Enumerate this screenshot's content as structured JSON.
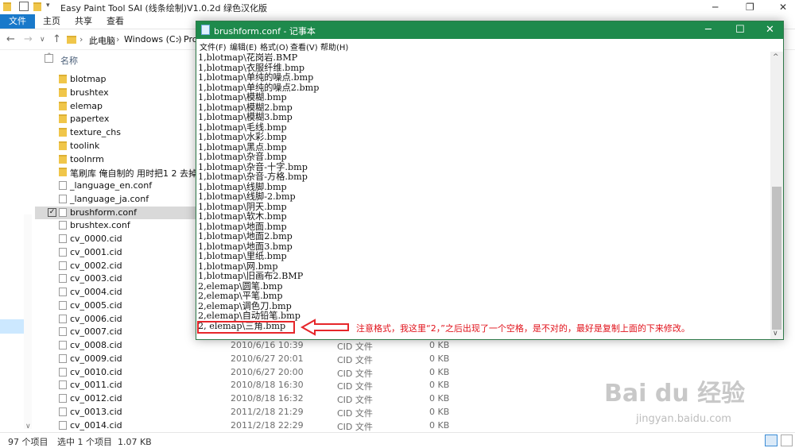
{
  "explorer": {
    "window_title": "Easy Paint Tool SAI (线条绘制)V1.0.2d 绿色汉化版",
    "ribbon_tabs": [
      "文件",
      "主页",
      "共享",
      "查看"
    ],
    "breadcrumb": [
      "此电脑",
      "Windows (C:)",
      "Pro"
    ],
    "column_name": "名称",
    "files": [
      {
        "name": "blotmap",
        "kind": "folder"
      },
      {
        "name": "brushtex",
        "kind": "folder"
      },
      {
        "name": "elemap",
        "kind": "folder"
      },
      {
        "name": "papertex",
        "kind": "folder"
      },
      {
        "name": "texture_chs",
        "kind": "folder"
      },
      {
        "name": "toolink",
        "kind": "folder"
      },
      {
        "name": "toolnrm",
        "kind": "folder"
      },
      {
        "name": "笔刷库 俺自制的 用时把1 2 去掉",
        "kind": "folder"
      },
      {
        "name": "_language_en.conf",
        "kind": "file"
      },
      {
        "name": "_language_ja.conf",
        "kind": "file"
      },
      {
        "name": "brushform.conf",
        "kind": "file",
        "selected": true
      },
      {
        "name": "brushtex.conf",
        "kind": "file"
      },
      {
        "name": "cv_0000.cid",
        "kind": "file"
      },
      {
        "name": "cv_0001.cid",
        "kind": "file"
      },
      {
        "name": "cv_0002.cid",
        "kind": "file"
      },
      {
        "name": "cv_0003.cid",
        "kind": "file"
      },
      {
        "name": "cv_0004.cid",
        "kind": "file"
      },
      {
        "name": "cv_0005.cid",
        "kind": "file"
      },
      {
        "name": "cv_0006.cid",
        "kind": "file"
      },
      {
        "name": "cv_0007.cid",
        "kind": "file"
      },
      {
        "name": "cv_0008.cid",
        "kind": "file",
        "date": "2010/6/16 10:39",
        "type": "CID 文件",
        "size": "0 KB"
      },
      {
        "name": "cv_0009.cid",
        "kind": "file",
        "date": "2010/6/27 20:01",
        "type": "CID 文件",
        "size": "0 KB"
      },
      {
        "name": "cv_0010.cid",
        "kind": "file",
        "date": "2010/6/27 20:00",
        "type": "CID 文件",
        "size": "0 KB"
      },
      {
        "name": "cv_0011.cid",
        "kind": "file",
        "date": "2010/8/18 16:30",
        "type": "CID 文件",
        "size": "0 KB"
      },
      {
        "name": "cv_0012.cid",
        "kind": "file",
        "date": "2010/8/18 16:32",
        "type": "CID 文件",
        "size": "0 KB"
      },
      {
        "name": "cv_0013.cid",
        "kind": "file",
        "date": "2011/2/18 21:29",
        "type": "CID 文件",
        "size": "0 KB"
      },
      {
        "name": "cv_0014.cid",
        "kind": "file",
        "date": "2011/2/18 22:29",
        "type": "CID 文件",
        "size": "0 KB"
      }
    ],
    "status": {
      "count": "97 个项目",
      "selection": "选中 1 个项目  1.07 KB"
    }
  },
  "notepad": {
    "title": "brushform.conf - 记事本",
    "menu": [
      "文件(F)",
      "编辑(E)",
      "格式(O)",
      "查看(V)",
      "帮助(H)"
    ],
    "lines": [
      "1,blotmap\\花岗岩.BMP",
      "1,blotmap\\衣服纤维.bmp",
      "1,blotmap\\单纯的噪点.bmp",
      "1,blotmap\\单纯的噪点2.bmp",
      "1,blotmap\\模糊.bmp",
      "1,blotmap\\模糊2.bmp",
      "1,blotmap\\模糊3.bmp",
      "1,blotmap\\毛线.bmp",
      "1,blotmap\\水彩.bmp",
      "1,blotmap\\黑点.bmp",
      "1,blotmap\\杂音.bmp",
      "1,blotmap\\杂音-十字.bmp",
      "1,blotmap\\杂音-方格.bmp",
      "1,blotmap\\线脚.bmp",
      "1,blotmap\\线脚-2.bmp",
      "1,blotmap\\阴天.bmp",
      "1,blotmap\\软木.bmp",
      "1,blotmap\\地面.bmp",
      "1,blotmap\\地面2.bmp",
      "1,blotmap\\地面3.bmp",
      "1,blotmap\\里纸.bmp",
      "1,blotmap\\网.bmp",
      "1,blotmap\\旧画布2.BMP",
      "2,elemap\\圆笔.bmp",
      "2,elemap\\平笔.bmp",
      "2,elemap\\调色刀.bmp",
      "2,elemap\\自动铅笔.bmp",
      "2, elemap\\三角.bmp"
    ]
  },
  "annotation": "注意格式，我这里“2，”之后出现了一个空格，是不对的，最好是复制上面的下来修改。",
  "watermark": {
    "logo": "Bai du 经验",
    "url": "jingyan.baidu.com"
  },
  "colors": {
    "accent": "#1e8a4c",
    "annotation": "#e1111a",
    "file_tab": "#1979ca"
  }
}
